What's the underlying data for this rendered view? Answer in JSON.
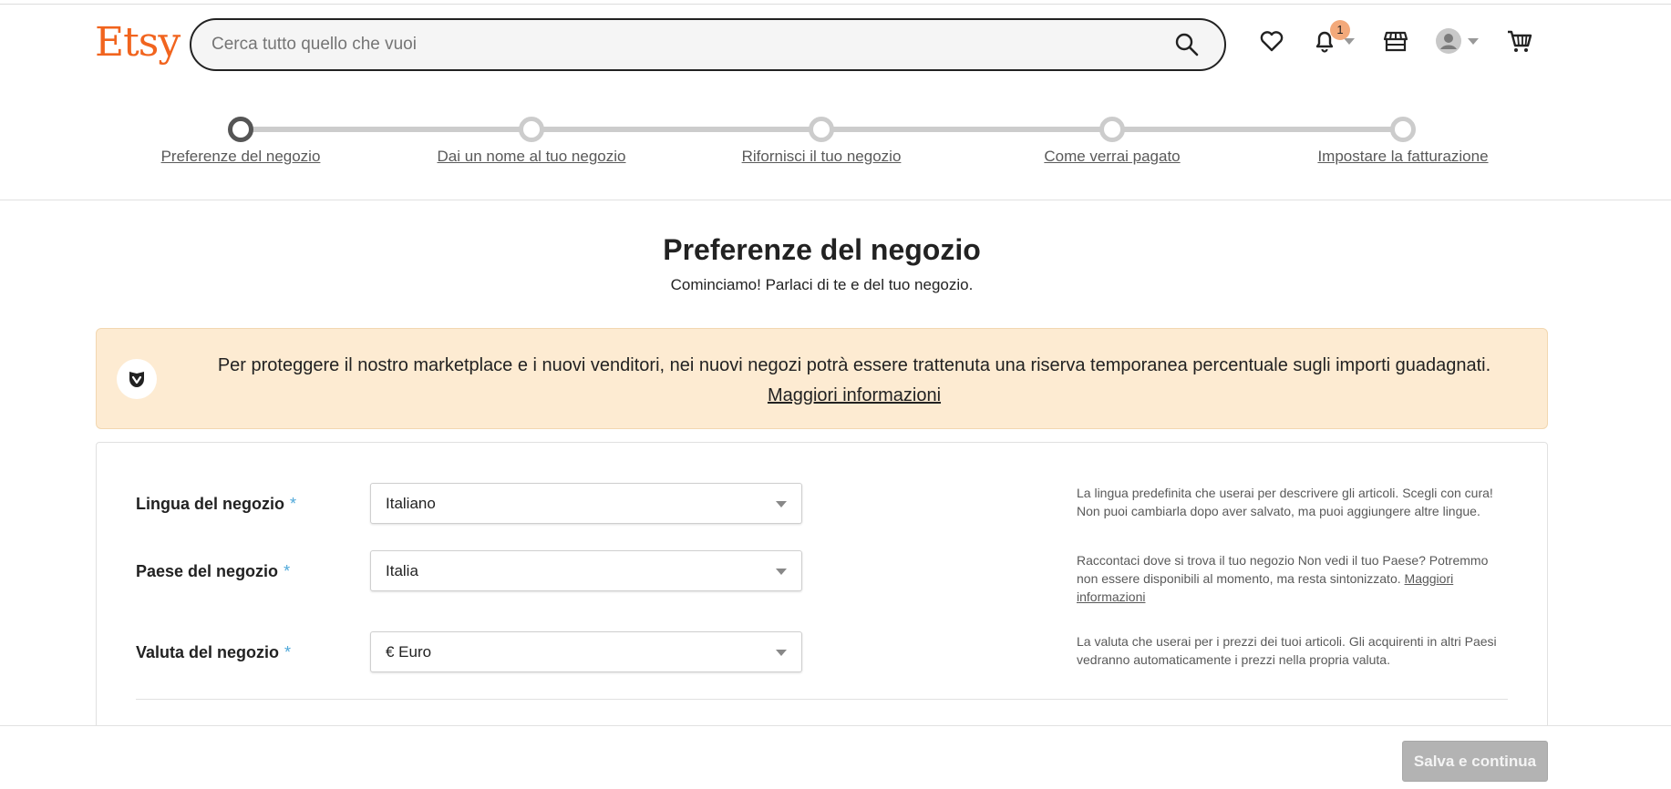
{
  "header": {
    "logo": "Etsy",
    "search_placeholder": "Cerca tutto quello che vuoi",
    "notification_count": "1"
  },
  "stepper": {
    "steps": [
      {
        "label": "Preferenze del negozio",
        "state": "active"
      },
      {
        "label": "Dai un nome al tuo negozio",
        "state": "inactive"
      },
      {
        "label": "Rifornisci il tuo negozio",
        "state": "inactive"
      },
      {
        "label": "Come verrai pagato",
        "state": "inactive"
      },
      {
        "label": "Impostare la fatturazione",
        "state": "inactive"
      }
    ]
  },
  "main": {
    "title": "Preferenze del negozio",
    "subtitle": "Cominciamo! Parlaci di te e del tuo negozio."
  },
  "banner": {
    "icon": "shield-icon",
    "text": "Per proteggere il nostro marketplace e i nuovi venditori, nei nuovi negozi potrà essere trattenuta una riserva temporanea percentuale sugli importi guadagnati.",
    "link": "Maggiori informazioni"
  },
  "form": {
    "required_marker": "*",
    "rows": [
      {
        "label": "Lingua del negozio",
        "value": "Italiano",
        "help": "La lingua predefinita che userai per descrivere gli articoli. Scegli con cura! Non puoi cambiarla dopo aver salvato, ma puoi aggiungere altre lingue."
      },
      {
        "label": "Paese del negozio",
        "value": "Italia",
        "help": "Raccontaci dove si trova il tuo negozio Non vedi il tuo Paese? Potremmo non essere disponibili al momento, ma resta sintonizzato.",
        "help_link": "Maggiori informazioni"
      },
      {
        "label": "Valuta del negozio",
        "value": "€ Euro",
        "help": "La valuta che userai per i prezzi dei tuoi articoli. Gli acquirenti in altri Paesi vedranno automaticamente i prezzi nella propria valuta."
      }
    ]
  },
  "footer": {
    "save_label": "Salva e continua"
  },
  "colors": {
    "brand": "#f1641e",
    "banner_bg": "#fdebd2",
    "required": "#4fa8d9",
    "button_disabled": "#b3b3b3"
  }
}
